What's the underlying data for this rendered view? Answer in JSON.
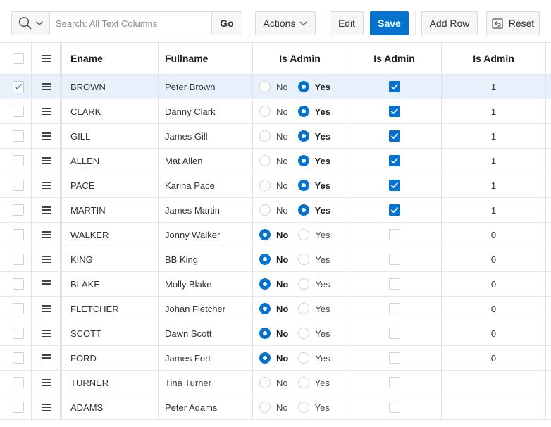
{
  "toolbar": {
    "search_placeholder": "Search: All Text Columns",
    "go_label": "Go",
    "actions_label": "Actions",
    "edit_label": "Edit",
    "save_label": "Save",
    "add_row_label": "Add Row",
    "reset_label": "Reset"
  },
  "columns": {
    "ename": "Ename",
    "fullname": "Fullname",
    "is_admin_radio": "Is Admin",
    "is_admin_check": "Is Admin",
    "is_admin_value": "Is Admin"
  },
  "radio_labels": {
    "no": "No",
    "yes": "Yes"
  },
  "colors": {
    "accent": "#0572ce",
    "selected_row": "#e8f1fb"
  },
  "rows": [
    {
      "ename": "BROWN",
      "fullname": "Peter Brown",
      "admin": "Yes",
      "value": "1",
      "selected": true
    },
    {
      "ename": "CLARK",
      "fullname": "Danny Clark",
      "admin": "Yes",
      "value": "1",
      "selected": false
    },
    {
      "ename": "GILL",
      "fullname": "James Gill",
      "admin": "Yes",
      "value": "1",
      "selected": false
    },
    {
      "ename": "ALLEN",
      "fullname": "Mat Allen",
      "admin": "Yes",
      "value": "1",
      "selected": false
    },
    {
      "ename": "PACE",
      "fullname": "Karina Pace",
      "admin": "Yes",
      "value": "1",
      "selected": false
    },
    {
      "ename": "MARTIN",
      "fullname": "James Martin",
      "admin": "Yes",
      "value": "1",
      "selected": false
    },
    {
      "ename": "WALKER",
      "fullname": "Jonny Walker",
      "admin": "No",
      "value": "0",
      "selected": false
    },
    {
      "ename": "KING",
      "fullname": "BB King",
      "admin": "No",
      "value": "0",
      "selected": false
    },
    {
      "ename": "BLAKE",
      "fullname": "Molly Blake",
      "admin": "No",
      "value": "0",
      "selected": false
    },
    {
      "ename": "FLETCHER",
      "fullname": "Johan Fletcher",
      "admin": "No",
      "value": "0",
      "selected": false
    },
    {
      "ename": "SCOTT",
      "fullname": "Dawn Scott",
      "admin": "No",
      "value": "0",
      "selected": false
    },
    {
      "ename": "FORD",
      "fullname": "James Fort",
      "admin": "No",
      "value": "0",
      "selected": false
    },
    {
      "ename": "TURNER",
      "fullname": "Tina Turner",
      "admin": "",
      "value": "",
      "selected": false
    },
    {
      "ename": "ADAMS",
      "fullname": "Peter Adams",
      "admin": "",
      "value": "",
      "selected": false
    }
  ]
}
